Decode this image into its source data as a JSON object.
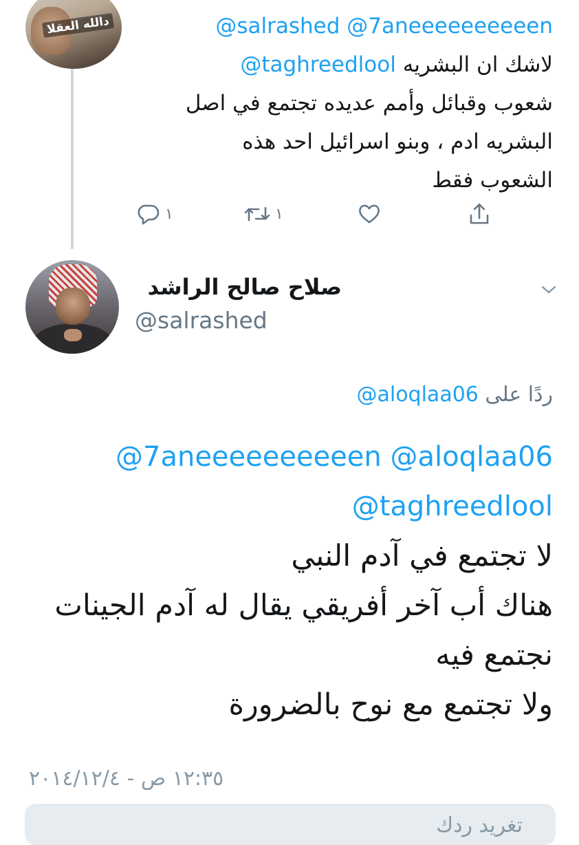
{
  "parent_tweet": {
    "mention_line_1": "@salrashed @7aneeeeeeeeeen",
    "mention_line_2": "@taghreedlool",
    "text_line_2_arabic": "لاشك ان البشريه",
    "text_line_3": "شعوب وقبائل وأمم عديده تجتمع في اصل",
    "text_line_4": "البشريه ادم ، وبنو اسرائيل احد هذه",
    "text_line_5": "الشعوب فقط",
    "avatar_overlay_text": "دالله العقلا",
    "actions": {
      "reply_count": "١",
      "retweet_count": "١",
      "like_count": "",
      "reply_icon": "reply-icon",
      "retweet_icon": "retweet-icon",
      "like_icon": "heart-icon",
      "share_icon": "share-icon"
    }
  },
  "main_tweet": {
    "display_name": "صلاح صالح الراشد",
    "handle": "@salrashed",
    "replying_to_label": "ردًا على",
    "replying_to_handle": "@aloqlaa06",
    "mention_line_1": "@7aneeeeeeeeeen @aloqlaa06",
    "mention_line_2": "@taghreedlool",
    "text_lines": [
      "لا تجتمع في آدم النبي",
      "هناك أب آخر أفريقي يقال له آدم الجينات",
      "نجتمع فيه",
      "ولا تجتمع مع نوح بالضرورة"
    ],
    "timestamp": "١٢:٣٥ ص - ٢٠١٤/١٢/٤",
    "caret_icon": "chevron-down-icon"
  },
  "reply_box": {
    "placeholder": "تغريد ردك"
  },
  "colors": {
    "mention": "#1da1f2",
    "secondary_text": "#657786",
    "thread_line": "#ccd6dd",
    "reply_box_bg": "#e6ecf0"
  }
}
